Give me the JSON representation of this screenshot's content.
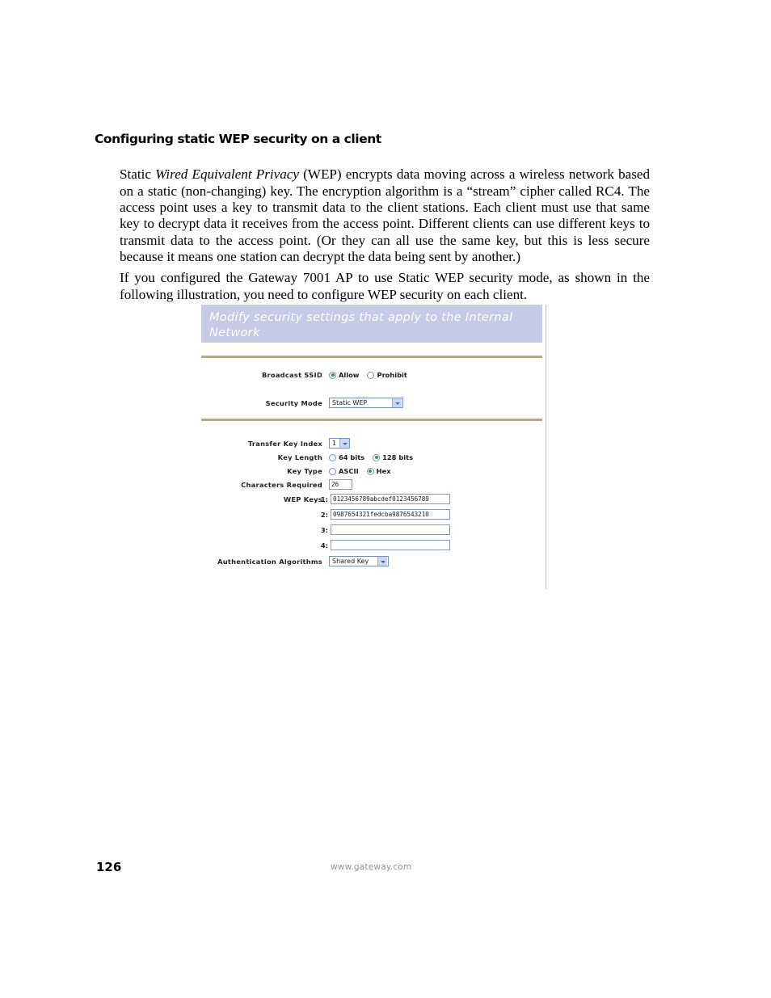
{
  "page": {
    "heading": "Configuring static WEP security on a client",
    "paragraph1_pre": "Static ",
    "paragraph1_em": "Wired Equivalent Privacy",
    "paragraph1_post": " (WEP) encrypts data moving across a wireless network based on a static (non-changing) key. The encryption algorithm is a “stream” cipher called RC4. The access point uses a key to transmit data to the client stations. Each client must use that same key to decrypt data it receives from the access point. Different clients can use different keys to transmit data to the access point. (Or they can all use the same key, but this is less secure because it means one station can decrypt the data being sent by another.)",
    "paragraph2": "If you configured the Gateway 7001 AP to use Static WEP security mode, as shown in the following illustration, you need to configure WEP security on each client."
  },
  "screenshot": {
    "header_title": "Modify security settings that apply to the Internal Network",
    "header_bg": "#c7cae6",
    "divider_color": "#b0a994",
    "fields": {
      "broadcast_ssid": {
        "label": "Broadcast SSID",
        "options": [
          {
            "label": "Allow",
            "selected": true
          },
          {
            "label": "Prohibit",
            "selected": false
          }
        ]
      },
      "security_mode": {
        "label": "Security Mode",
        "value": "Static WEP"
      },
      "transfer_key_index": {
        "label": "Transfer Key Index",
        "value": "1"
      },
      "key_length": {
        "label": "Key Length",
        "options": [
          {
            "label": "64 bits",
            "selected": false
          },
          {
            "label": "128 bits",
            "selected": true
          }
        ]
      },
      "key_type": {
        "label": "Key Type",
        "options": [
          {
            "label": "ASCII",
            "selected": false
          },
          {
            "label": "Hex",
            "selected": true
          }
        ]
      },
      "characters_required": {
        "label": "Characters Required",
        "value": "26"
      },
      "wep_keys": {
        "label": "WEP Keys",
        "rows": [
          {
            "num": "1:",
            "value": "0123456789abcdef0123456789"
          },
          {
            "num": "2:",
            "value": "0987654321fedcba9876543210"
          },
          {
            "num": "3:",
            "value": ""
          },
          {
            "num": "4:",
            "value": ""
          }
        ]
      },
      "authentication_algorithms": {
        "label": "Authentication Algorithms",
        "value": "Shared Key"
      }
    }
  },
  "footer": {
    "page_number": "126",
    "url": "www.gateway.com"
  }
}
